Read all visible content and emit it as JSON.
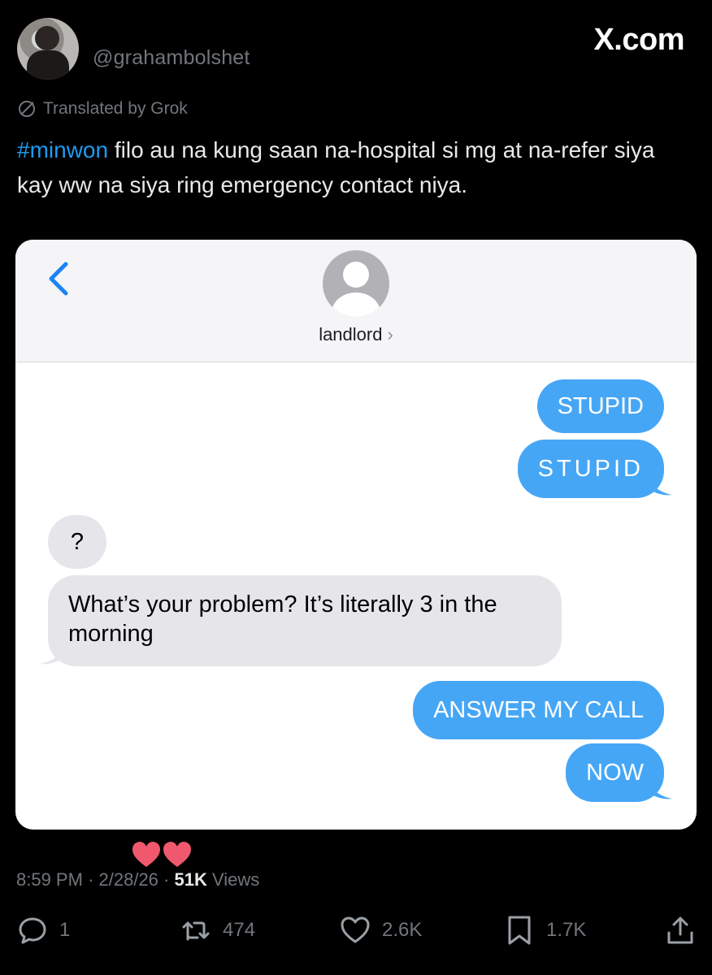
{
  "post": {
    "handle": "@grahambolshet",
    "source_label": "X.com",
    "translated_label": "Translated by Grok",
    "hashtag": "#minwon",
    "text_rest": " filo au na kung saan na-hospital si mg at na-refer siya kay ww na siya ring emergency contact niya.",
    "time": "8:59 PM",
    "date": "2/28/26",
    "views_count": "51K",
    "views_label": "Views"
  },
  "chat": {
    "contact_name": "landlord",
    "messages": [
      {
        "from": "me",
        "text": "STUPID"
      },
      {
        "from": "me",
        "text": "STUPID"
      },
      {
        "from": "them",
        "text": "?"
      },
      {
        "from": "them",
        "text": "What’s your problem? It’s literally 3 in the morning"
      },
      {
        "from": "me",
        "text": "ANSWER MY CALL"
      },
      {
        "from": "me",
        "text": "NOW"
      }
    ]
  },
  "actions": {
    "replies": "1",
    "reposts": "474",
    "likes": "2.6K",
    "bookmarks": "1.7K"
  },
  "colors": {
    "background": "#000000",
    "link_blue": "#1d9bf0",
    "imessage_blue": "#46a6f6",
    "incoming_gray": "#e6e5ea",
    "heart_pink": "#f0586d"
  },
  "icons": [
    "back-chevron-icon",
    "contact-placeholder-icon",
    "heart-icon",
    "reply-icon",
    "repost-icon",
    "like-icon",
    "bookmark-icon",
    "share-icon",
    "grok-translate-icon"
  ]
}
